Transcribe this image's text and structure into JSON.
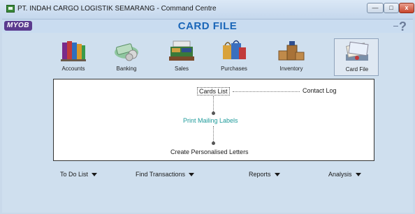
{
  "window": {
    "title": "PT. INDAH CARGO LOGISTIK SEMARANG - Command Centre",
    "minimize_label": "—",
    "maximize_label": "□",
    "close_label": "x"
  },
  "header": {
    "logo": "MYOB",
    "module_title": "CARD FILE",
    "help_label": "?"
  },
  "modules": [
    {
      "label": "Accounts",
      "icon": "accounts-books-icon"
    },
    {
      "label": "Banking",
      "icon": "banking-money-icon"
    },
    {
      "label": "Sales",
      "icon": "sales-register-icon"
    },
    {
      "label": "Purchases",
      "icon": "purchases-bags-icon"
    },
    {
      "label": "Inventory",
      "icon": "inventory-boxes-icon"
    },
    {
      "label": "Card File",
      "icon": "card-file-rolodex-icon",
      "active": true
    }
  ],
  "panel": {
    "cards_list": "Cards List",
    "contact_log": "Contact Log",
    "print_mailing_labels": "Print Mailing Labels",
    "create_personalised_letters": "Create Personalised Letters"
  },
  "bottom_menu": {
    "todo": "To Do List",
    "find_transactions": "Find Transactions",
    "reports": "Reports",
    "analysis": "Analysis"
  },
  "colors": {
    "title_blue": "#1a66b8",
    "teal_link": "#1d9a9a",
    "background": "#cfdfee"
  }
}
